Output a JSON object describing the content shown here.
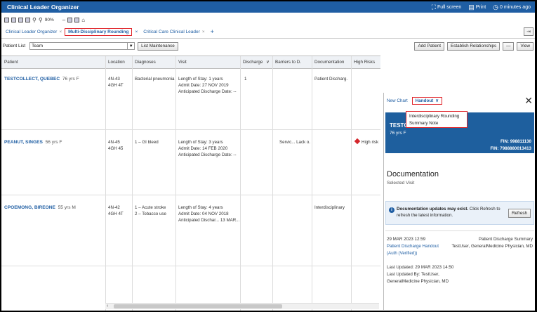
{
  "app": {
    "title": "Clinical Leader Organizer",
    "tools": {
      "fullscreen": "Full screen",
      "print": "Print",
      "elapsed": "0 minutes ago"
    }
  },
  "toolbar": {
    "zoom": "90%"
  },
  "tabs": [
    {
      "label": "Clinical Leader Organizer"
    },
    {
      "label": "Multi-Disciplinary Rounding"
    },
    {
      "label": "Critical Care Clinical Leader"
    }
  ],
  "patient_list": {
    "label": "Patient List",
    "value": "Team",
    "list_maintenance": "List Maintenance",
    "add_patient": "Add Patient",
    "establish_relationships": "Establish Relationships",
    "minus": "—",
    "view": "View"
  },
  "columns": [
    "Patient",
    "Location",
    "Diagnoses",
    "Visit",
    "Discharge",
    "Barriers to D.",
    "Documentation",
    "High Risks"
  ],
  "rows": [
    {
      "name": "TESTCOLLECT, QUEBEC",
      "meta": "76 yrs F",
      "location": [
        "4N-43",
        "4GH 4T"
      ],
      "diagnoses": [
        "Bacterial pneumonia"
      ],
      "visit": [
        "Length of Stay: 1 years",
        "Admit Date: 27 NOV 2019",
        "Anticipated Discharge Date: --"
      ],
      "discharge": "1",
      "barriers": "",
      "documentation": "Patient Discharg.",
      "high_risk": ""
    },
    {
      "name": "PEANUT, SINGES",
      "meta": "56 yrs F",
      "location": [
        "4N-45",
        "4GH 45"
      ],
      "diagnoses": [
        "1 – GI bleed"
      ],
      "visit": [
        "Length of Stay: 3 years",
        "Admit Date: 14 FEB 2020",
        "Anticipated Discharge Date: --"
      ],
      "discharge": "",
      "barriers": "Servic... Lack o.",
      "documentation": "",
      "high_risk": "High risk"
    },
    {
      "name": "CPOEMONG, BIREONE",
      "meta": "55 yrs M",
      "location": [
        "4N-42",
        "4GH 4T"
      ],
      "diagnoses": [
        "1 – Acute stroke",
        "2 – Tobacco use"
      ],
      "visit": [
        "Length of Stay: 4 years",
        "Admit Date: 04 NOV 2018",
        "Anticipated Dischar... 13 MAR..."
      ],
      "discharge": "",
      "barriers": "",
      "documentation": "Interdisciplinary",
      "high_risk": ""
    }
  ],
  "panel": {
    "new_chart": "New Chart",
    "handout": "Handout",
    "banner_name": "TESTC",
    "banner_sub": "76 yrs F",
    "fin": "FIN: 998811130",
    "mrn": "FIN: 7988880013413",
    "menu": [
      "Interdisciplinary Rounding",
      "Summary Note"
    ],
    "doc_title": "Documentation",
    "doc_sub": "Selected Visit",
    "alert_bold": "Documentation updates may exist.",
    "alert_rest": " Click Refresh to refresh the latest information.",
    "refresh": "Refresh",
    "entry": {
      "date": "29 MAR 2023 12:59",
      "kind": "Patient Discharge Summary",
      "who": "TestUser, GeneralMedicine Physician, MD",
      "link": "Patient Discharge Handout (Auth (Verified))",
      "last_updated": "Last Updated: 29 MAR 2023 14:50",
      "last_updated_by": "Last Updated By: TestUser,",
      "physician": "GeneralMedicine Physician, MD"
    }
  },
  "colors": {
    "brand": "#1f5ea3",
    "highlight": "#e0252b",
    "risk": "#d4262b"
  }
}
